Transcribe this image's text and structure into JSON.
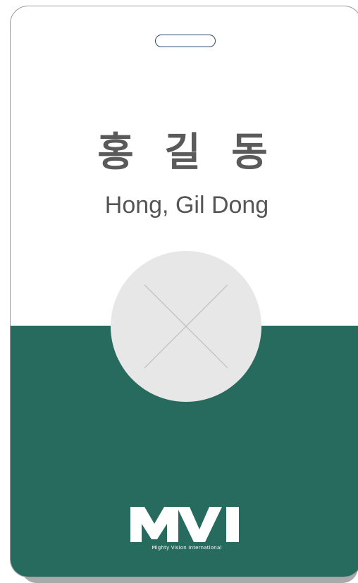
{
  "card": {
    "name_korean": "홍 길 동",
    "name_english": "Hong, Gil Dong",
    "photo_placeholder_icon": "x-placeholder-icon"
  },
  "logo": {
    "mark": "MVI",
    "tagline": "Mighty Vision International"
  },
  "colors": {
    "accent": "#276b5e",
    "text": "#5a5a5a",
    "photo_bg": "#e6e7e6"
  }
}
